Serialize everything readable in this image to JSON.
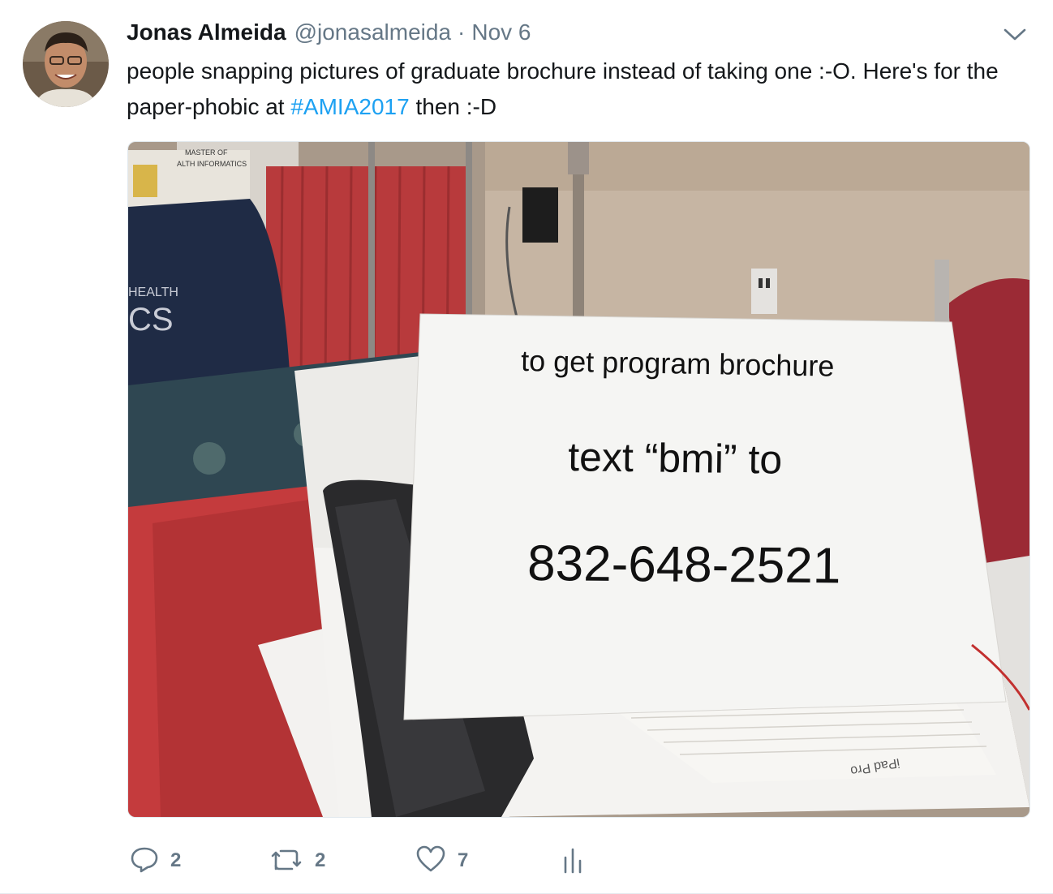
{
  "tweet": {
    "author_name": "Jonas Almeida",
    "author_handle": "@jonasalmeida",
    "separator": "·",
    "timestamp": "Nov 6",
    "text_part1": "people snapping pictures of graduate brochure instead of taking one :-O. Here's for the paper-phobic at ",
    "hashtag": "#AMIA2017",
    "text_part2": " then :-D",
    "hashtag_color": "#1da1f2"
  },
  "photo": {
    "sign_line1": "to get program brochure",
    "sign_line2": "text “bmi” to",
    "sign_line3": "832-648-2521",
    "booth_banner_line1": "MASTER OF",
    "booth_banner_line2": "ALTH INFORMATICS",
    "booth_table_text1": "HEALTH",
    "booth_table_text2": "CS",
    "box_label": "iPad Pro"
  },
  "actions": {
    "reply_count": "2",
    "retweet_count": "2",
    "like_count": "7",
    "reply_icon": "reply-icon",
    "retweet_icon": "retweet-icon",
    "like_icon": "heart-icon",
    "analytics_icon": "analytics-icon"
  }
}
